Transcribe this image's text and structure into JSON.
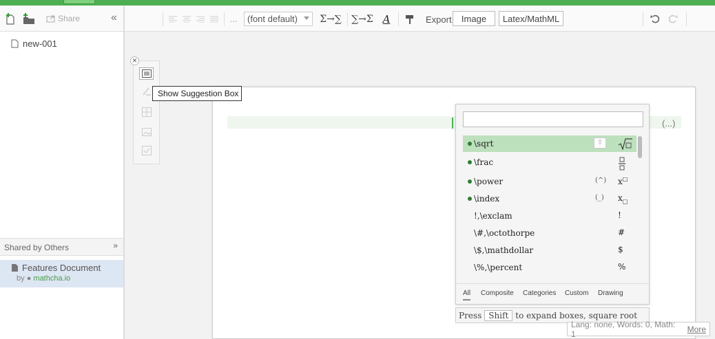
{
  "sidebar": {
    "share_label": "Share",
    "collapse_glyph": "«",
    "files": [
      {
        "name": "new-001"
      }
    ],
    "shared": {
      "header": "Shared by Others",
      "items": [
        {
          "title": "Features Document",
          "by_prefix": "by",
          "user": "mathcha.io"
        }
      ]
    }
  },
  "toolbar": {
    "font_select": "(font default)",
    "sigma1": "Σ→∑",
    "sigma2": "∑→Σ",
    "font_color_glyph": "A",
    "more_glyph": "...",
    "export_label": "Export:",
    "export_image": "Image",
    "export_latex": "Latex/MathML"
  },
  "editor": {
    "ellipsis": "(...)"
  },
  "tooltip": {
    "text": "Show Suggestion Box"
  },
  "suggestions": {
    "items": [
      {
        "name": "\\sqrt",
        "key": "",
        "sym": "√□",
        "selected": true,
        "dot": true
      },
      {
        "name": "\\frac",
        "key": "",
        "sym": "□/□",
        "selected": false,
        "dot": true
      },
      {
        "name": "\\power",
        "key": "(^)",
        "sym": "x□",
        "selected": false,
        "dot": true
      },
      {
        "name": "\\index",
        "key": "(_)",
        "sym": "x□",
        "selected": false,
        "dot": true
      },
      {
        "name": "!,\\exclam",
        "key": "",
        "sym": "!",
        "selected": false,
        "dot": false
      },
      {
        "name": "\\#,\\octothorpe",
        "key": "",
        "sym": "#",
        "selected": false,
        "dot": false
      },
      {
        "name": "\\$,\\mathdollar",
        "key": "",
        "sym": "$",
        "selected": false,
        "dot": false
      },
      {
        "name": "\\%,\\percent",
        "key": "",
        "sym": "%",
        "selected": false,
        "dot": false
      }
    ],
    "tabs": [
      "All",
      "Composite",
      "Categories",
      "Custom",
      "Drawing"
    ],
    "active_tab": "All"
  },
  "hint": {
    "prefix": "Press",
    "key": "Shift",
    "suffix": "to expand boxes, square root"
  },
  "status": {
    "text": "Lang: none, Words: 0, Math: 1",
    "more": "More"
  },
  "colors": {
    "accent": "#4caf50",
    "selected_row": "#bde0bd",
    "shared_item_bg": "#dde6f3"
  }
}
